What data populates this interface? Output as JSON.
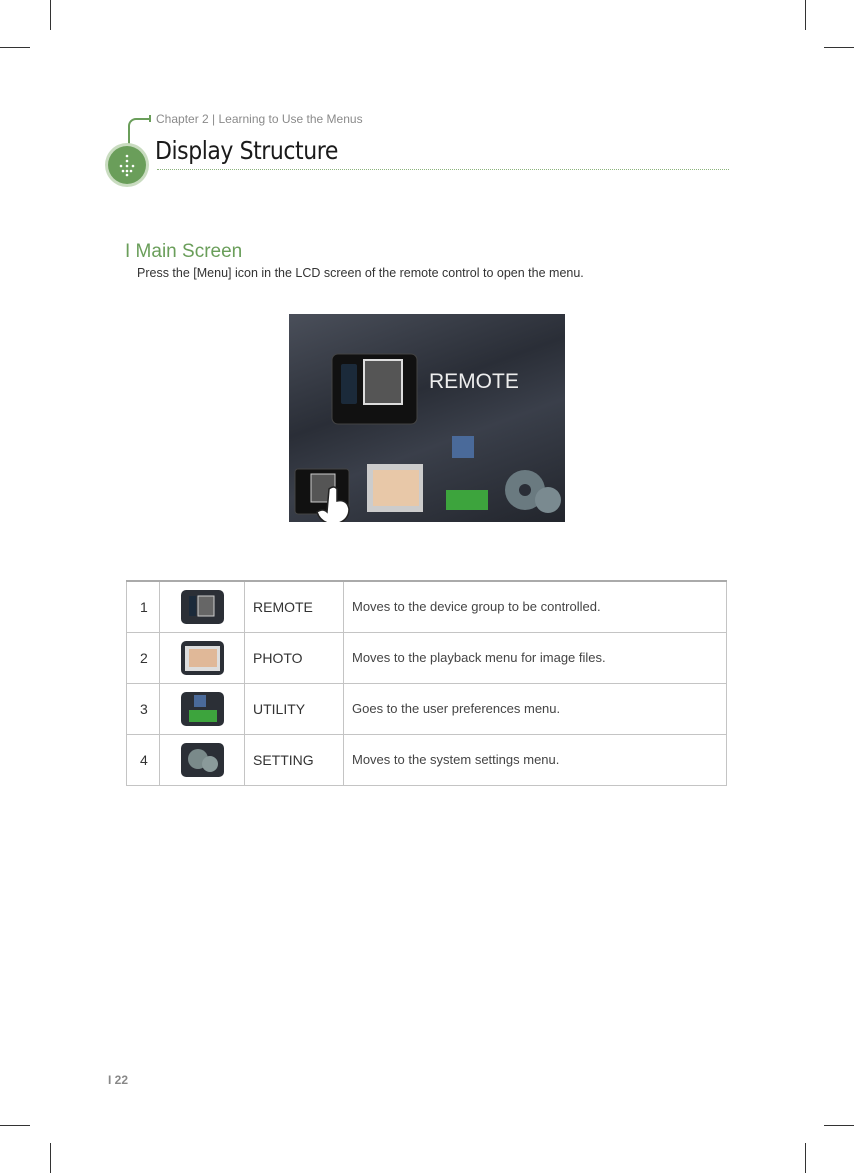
{
  "header": {
    "chapter": "Chapter 2 | Learning to Use the Menus",
    "title": "Display Structure"
  },
  "section": {
    "title": "I Main Screen",
    "intro": "Press the [Menu] icon in the LCD screen of the remote control to open the menu."
  },
  "screen": {
    "label": "REMOTE",
    "icons": [
      "remote-icon",
      "photo-icon",
      "utility-icon",
      "setting-icon"
    ]
  },
  "table": {
    "rows": [
      {
        "num": "1",
        "icon": "remote-icon",
        "label": "REMOTE",
        "desc": "Moves to the device group to be controlled."
      },
      {
        "num": "2",
        "icon": "photo-icon",
        "label": "PHOTO",
        "desc": "Moves to the playback menu for image files."
      },
      {
        "num": "3",
        "icon": "utility-icon",
        "label": "UTILITY",
        "desc": "Goes to the user preferences menu."
      },
      {
        "num": "4",
        "icon": "setting-icon",
        "label": "SETTING",
        "desc": "Moves to the system settings menu."
      }
    ]
  },
  "footer": {
    "page": "I 22"
  },
  "colors": {
    "accent": "#6a9e5a"
  }
}
